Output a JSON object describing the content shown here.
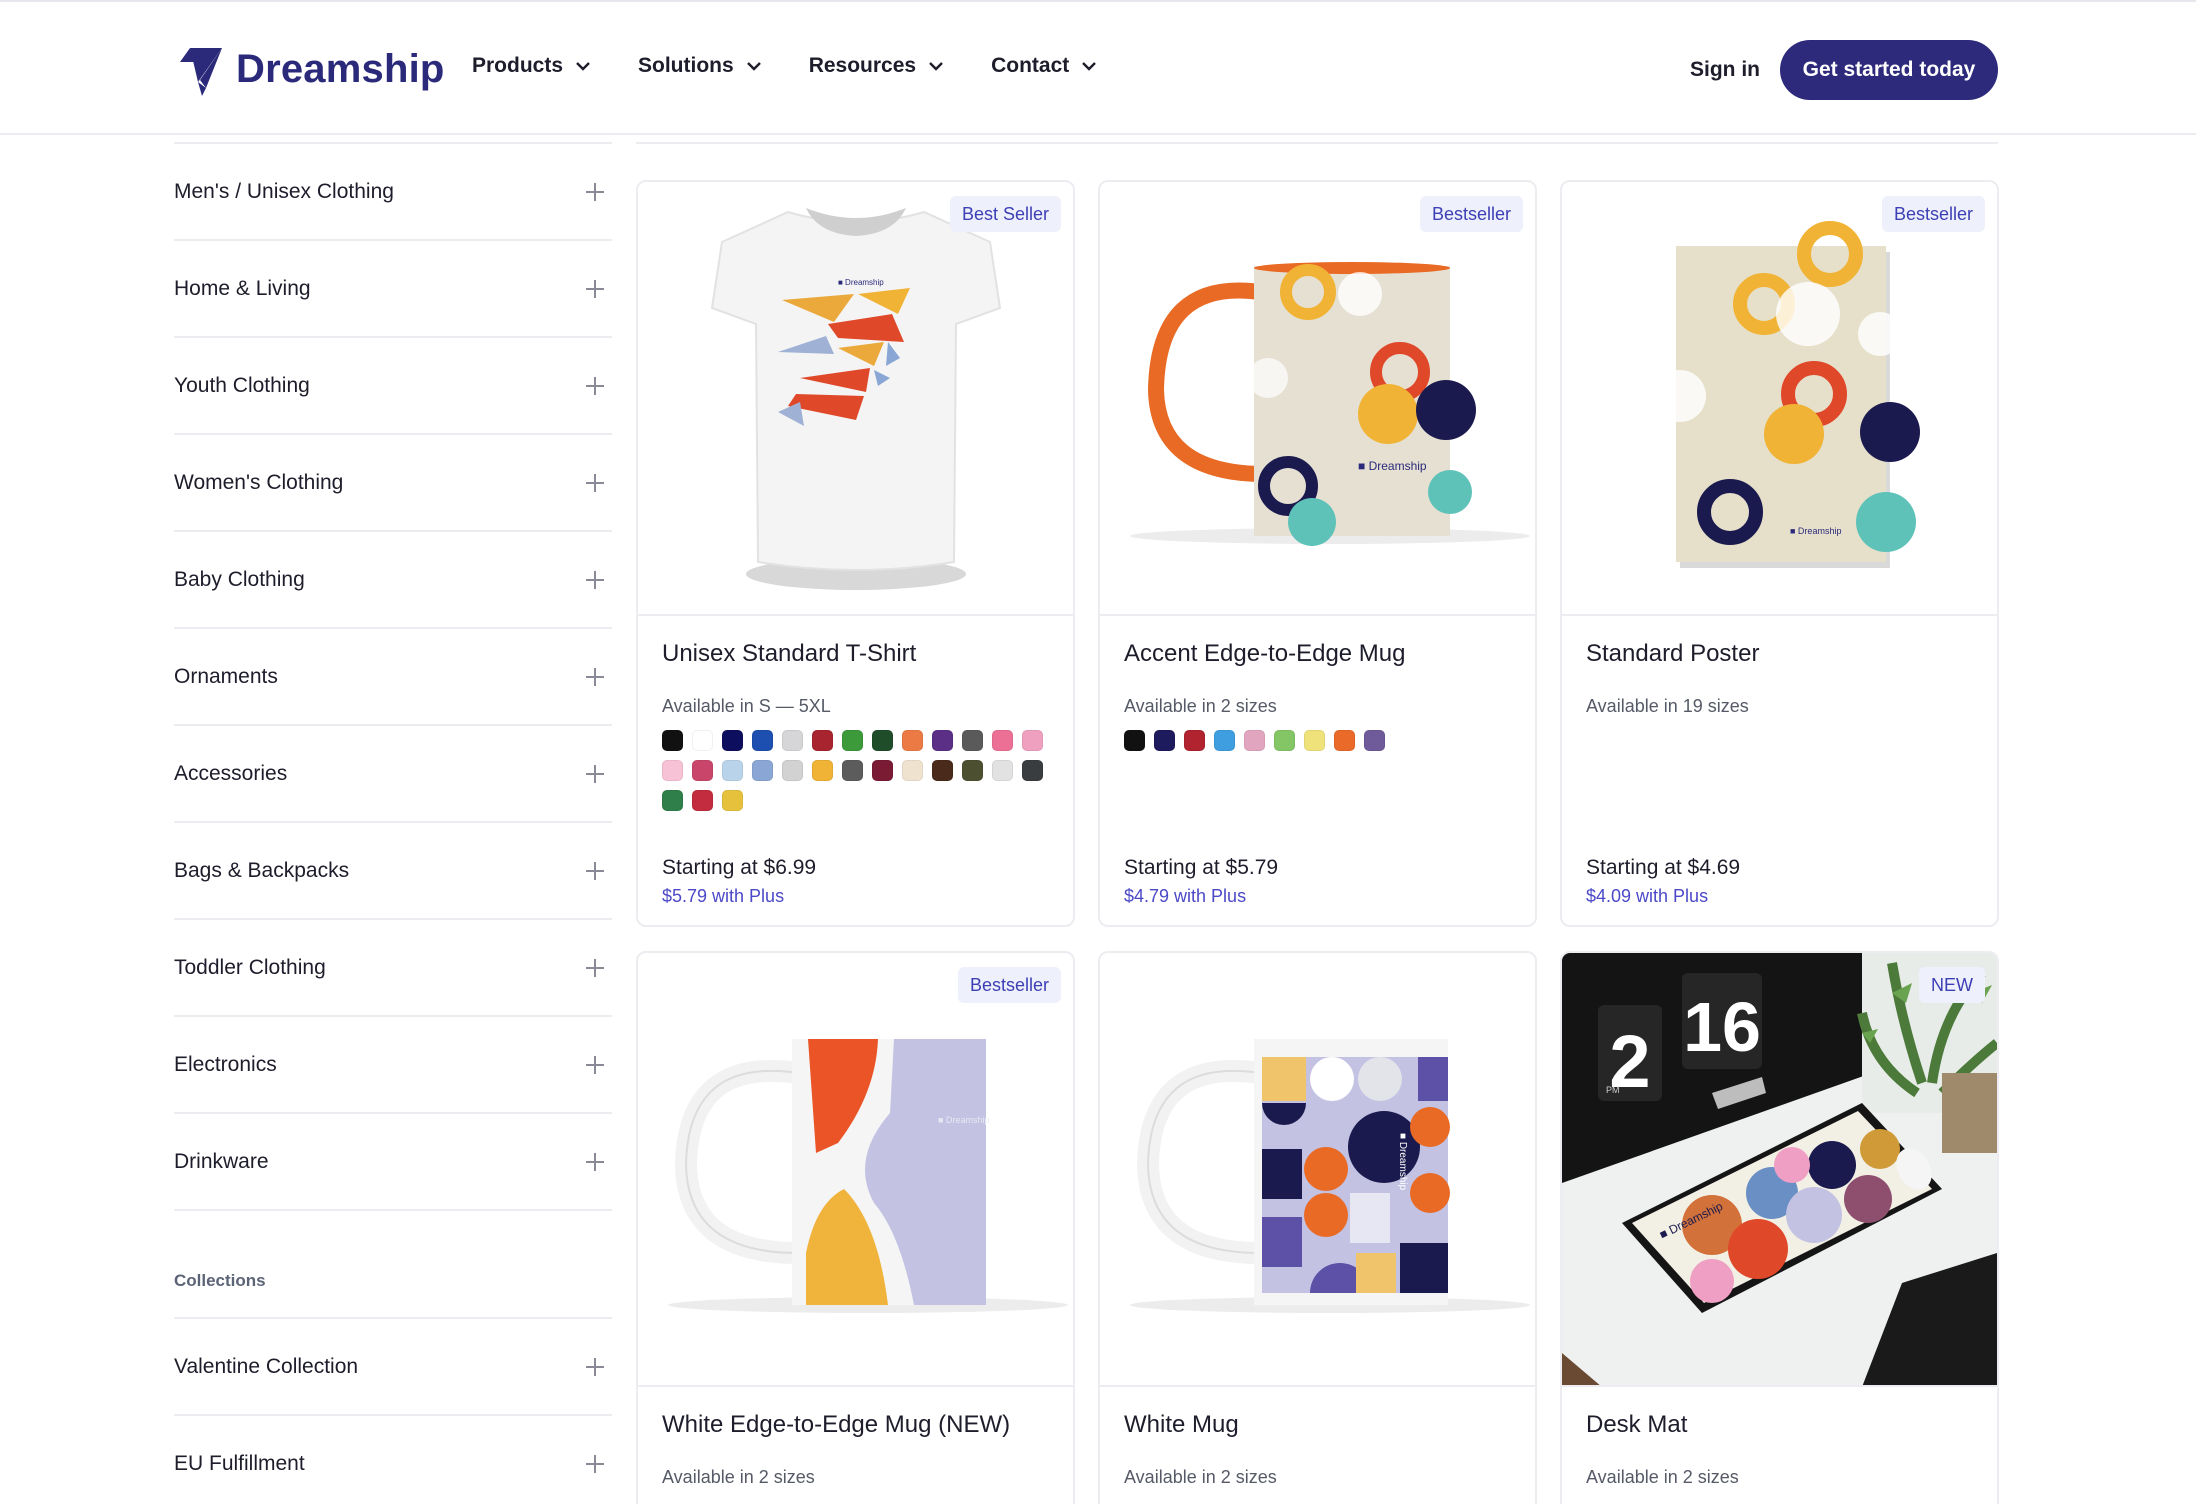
{
  "brand": {
    "name": "Dreamship"
  },
  "nav": {
    "items": [
      {
        "label": "Products"
      },
      {
        "label": "Solutions"
      },
      {
        "label": "Resources"
      },
      {
        "label": "Contact"
      }
    ],
    "signin": "Sign in",
    "cta": "Get started today"
  },
  "sidebar": {
    "categories": [
      {
        "label": "Men's / Unisex Clothing"
      },
      {
        "label": "Home & Living"
      },
      {
        "label": "Youth Clothing"
      },
      {
        "label": "Women's Clothing"
      },
      {
        "label": "Baby Clothing"
      },
      {
        "label": "Ornaments"
      },
      {
        "label": "Accessories"
      },
      {
        "label": "Bags & Backpacks"
      },
      {
        "label": "Toddler Clothing"
      },
      {
        "label": "Electronics"
      },
      {
        "label": "Drinkware"
      }
    ],
    "collections_heading": "Collections",
    "collections": [
      {
        "label": "Valentine Collection"
      },
      {
        "label": "EU Fulfillment"
      }
    ]
  },
  "products": [
    {
      "badge": "Best Seller",
      "title": "Unisex Standard T-Shirt",
      "availability": "Available in S — 5XL",
      "price": "Starting at $6.99",
      "plus_price": "$5.79 with Plus",
      "swatches": [
        "#111111",
        "#ffffff",
        "#0e0e5e",
        "#1c4fb0",
        "#d6d6d9",
        "#a8242e",
        "#3c9a3a",
        "#1f4d2a",
        "#ec7a44",
        "#5c2f86",
        "#5a5a5a",
        "#ec6f95",
        "#f0a0bf",
        "#f7c2d5",
        "#c9466a",
        "#b9d4ea",
        "#8aa6d4",
        "#d2d2d2",
        "#f0b335",
        "#5c5c5c",
        "#7a1a33",
        "#efe3cf",
        "#4a2a1a",
        "#4d5030",
        "#e2e2e2",
        "#3a3d40",
        "#2f7f4a",
        "#c22c3e",
        "#e6c23c"
      ]
    },
    {
      "badge": "Bestseller",
      "title": "Accent Edge-to-Edge Mug",
      "availability": "Available in 2 sizes",
      "price": "Starting at $5.79",
      "plus_price": "$4.79 with Plus",
      "swatches": [
        "#111111",
        "#1e1a5e",
        "#b0232f",
        "#3e9ee0",
        "#e2a5bf",
        "#84c565",
        "#f0e27a",
        "#ea6a2a",
        "#6f5b9a"
      ]
    },
    {
      "badge": "Bestseller",
      "title": "Standard Poster",
      "availability": "Available in 19 sizes",
      "price": "Starting at $4.69",
      "plus_price": "$4.09 with Plus",
      "swatches": []
    },
    {
      "badge": "Bestseller",
      "title": "White Edge-to-Edge Mug (NEW)",
      "availability": "Available in 2 sizes",
      "swatches": []
    },
    {
      "badge": "",
      "title": "White Mug",
      "availability": "Available in 2 sizes",
      "swatches": []
    },
    {
      "badge": "NEW",
      "title": "Desk Mat",
      "availability": "Available in 2 sizes",
      "clock": {
        "hour": "2",
        "minute": "16",
        "ampm": "PM"
      },
      "swatches": []
    }
  ]
}
